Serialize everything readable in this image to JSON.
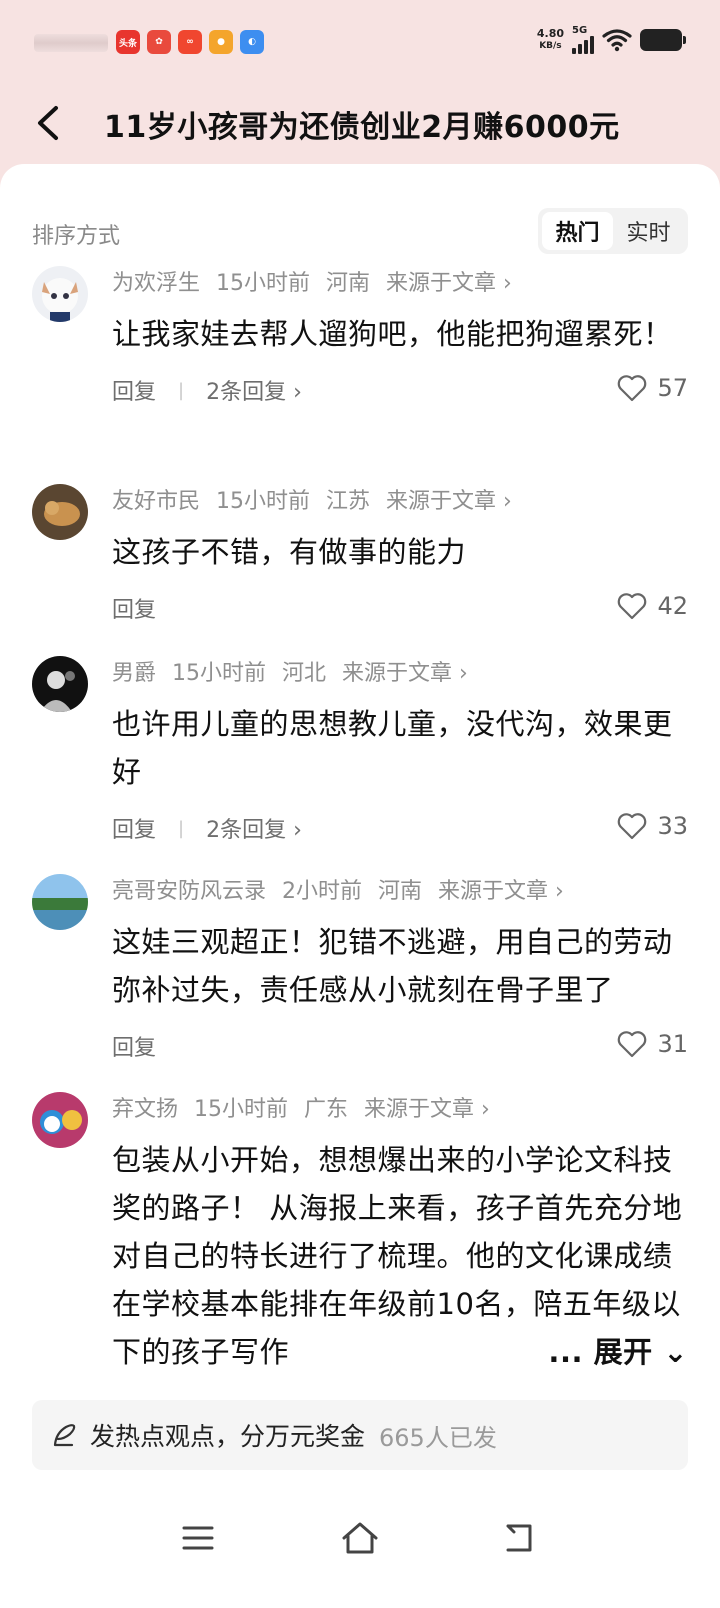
{
  "status_bar": {
    "speed_value": "4.80",
    "speed_unit": "KB/s",
    "network": "5G",
    "app_icons": [
      {
        "name": "toutiao-icon",
        "label": "头条",
        "color": "#e8352e"
      },
      {
        "name": "app-icon-2",
        "label": "",
        "color": "#e94a3d"
      },
      {
        "name": "app-icon-3",
        "label": "",
        "color": "#f0462f"
      },
      {
        "name": "app-icon-4",
        "label": "",
        "color": "#f4a52c"
      },
      {
        "name": "app-icon-5",
        "label": "",
        "color": "#3d8ef0"
      }
    ]
  },
  "header": {
    "title": "11岁小孩哥为还债创业2月赚6000元"
  },
  "sort": {
    "label": "排序方式",
    "options": [
      "热门",
      "实时"
    ],
    "selected": "热门"
  },
  "comments": [
    {
      "user": "为欢浮生",
      "time": "15小时前",
      "region": "河南",
      "source": "来源于文章",
      "text": "让我家娃去帮人遛狗吧，他能把狗遛累死！",
      "reply": "回复",
      "replies": "2条回复",
      "likes": "57"
    },
    {
      "user": "友好市民",
      "time": "15小时前",
      "region": "江苏",
      "source": "来源于文章",
      "text": "这孩子不错，有做事的能力",
      "reply": "回复",
      "replies": "",
      "likes": "42"
    },
    {
      "user": "男爵",
      "time": "15小时前",
      "region": "河北",
      "source": "来源于文章",
      "text": "也许用儿童的思想教儿童，没代沟，效果更好",
      "reply": "回复",
      "replies": "2条回复",
      "likes": "33"
    },
    {
      "user": "亮哥安防风云录",
      "time": "2小时前",
      "region": "河南",
      "source": "来源于文章",
      "text": "这娃三观超正！犯错不逃避，用自己的劳动弥补过失，责任感从小就刻在骨子里了",
      "reply": "回复",
      "replies": "",
      "likes": "31"
    },
    {
      "user": "弃文扬",
      "time": "15小时前",
      "region": "广东",
      "source": "来源于文章",
      "text": "包装从小开始，想想爆出来的小学论文科技奖的路子！ 从海报上来看，孩子首先充分地对自己的特长进行了梳理。他的文化课成绩在学校基本能排在年级前10名，陪五年级以下的孩子写作",
      "expand": "... 展开"
    }
  ],
  "bottom_bar": {
    "prompt": "发热点观点，分万元奖金",
    "count": "665人已发"
  }
}
